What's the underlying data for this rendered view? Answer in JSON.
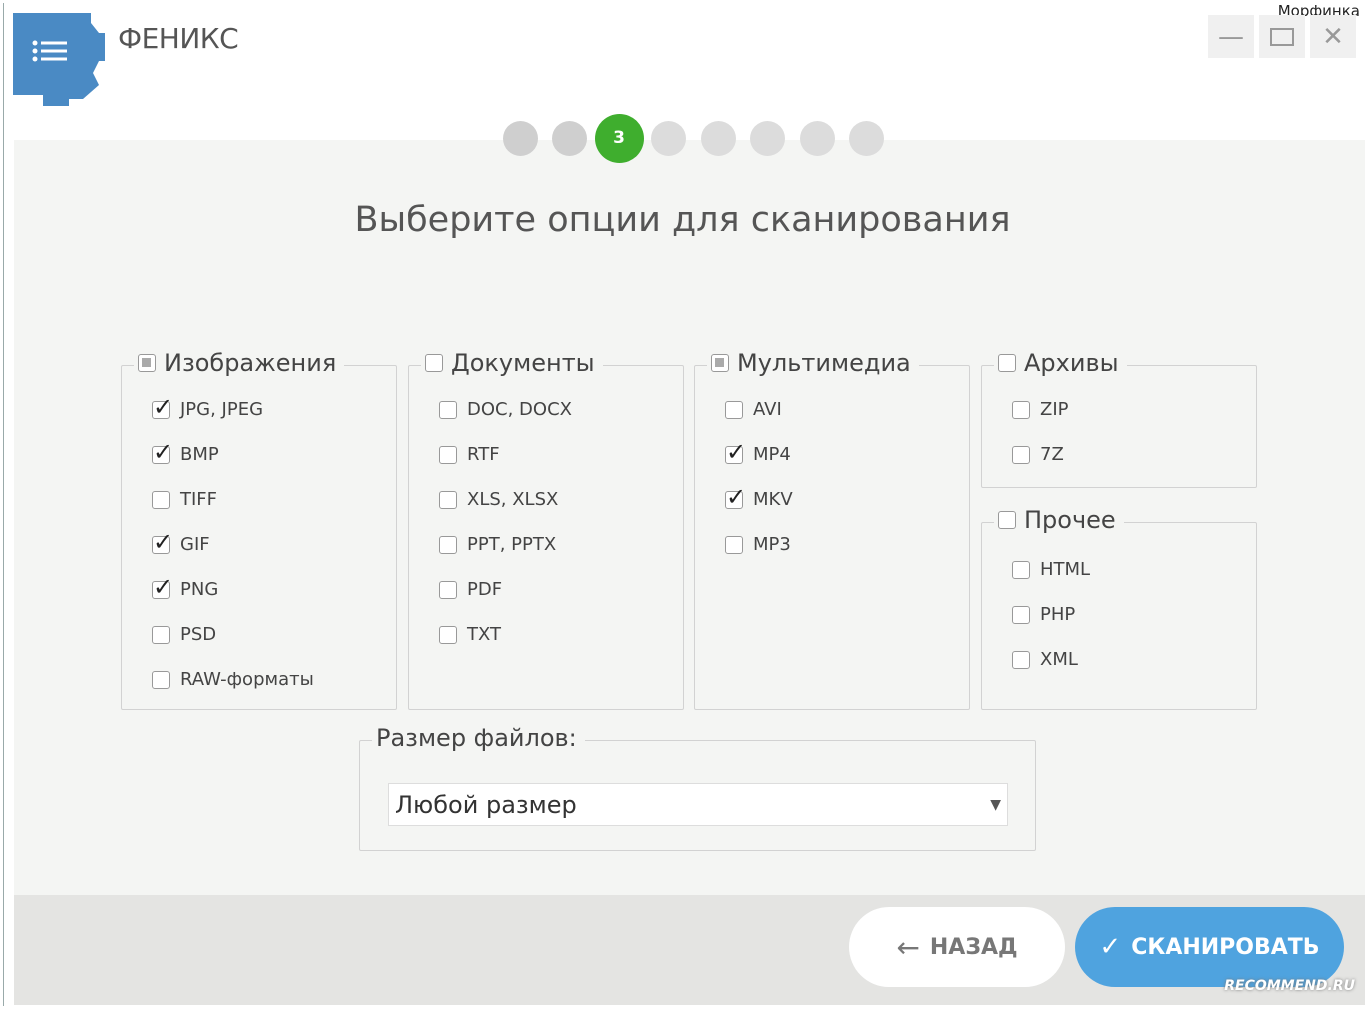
{
  "app": {
    "title": "ФЕНИКС",
    "user": "Морфинка"
  },
  "steps": {
    "current": "3",
    "total": 8,
    "current_index": 3
  },
  "heading": "Выберите опции для сканирования",
  "groups": [
    {
      "label": "Изображения",
      "state": "indeterminate",
      "items": [
        {
          "label": "JPG, JPEG",
          "checked": true
        },
        {
          "label": "BMP",
          "checked": true
        },
        {
          "label": "TIFF",
          "checked": false
        },
        {
          "label": "GIF",
          "checked": true
        },
        {
          "label": "PNG",
          "checked": true
        },
        {
          "label": "PSD",
          "checked": false
        },
        {
          "label": "RAW-форматы",
          "checked": false
        }
      ]
    },
    {
      "label": "Документы",
      "state": "unchecked",
      "items": [
        {
          "label": "DOC, DOCX",
          "checked": false
        },
        {
          "label": "RTF",
          "checked": false
        },
        {
          "label": "XLS, XLSX",
          "checked": false
        },
        {
          "label": "PPT, PPTX",
          "checked": false
        },
        {
          "label": "PDF",
          "checked": false
        },
        {
          "label": "TXT",
          "checked": false
        }
      ]
    },
    {
      "label": "Мультимедиа",
      "state": "indeterminate",
      "items": [
        {
          "label": "AVI",
          "checked": false
        },
        {
          "label": "MP4",
          "checked": true
        },
        {
          "label": "MKV",
          "checked": true
        },
        {
          "label": "MP3",
          "checked": false
        }
      ]
    },
    {
      "label": "Архивы",
      "state": "unchecked",
      "items": [
        {
          "label": "ZIP",
          "checked": false
        },
        {
          "label": "7Z",
          "checked": false
        }
      ]
    },
    {
      "label": "Прочее",
      "state": "unchecked",
      "items": [
        {
          "label": "HTML",
          "checked": false
        },
        {
          "label": "PHP",
          "checked": false
        },
        {
          "label": "XML",
          "checked": false
        }
      ]
    }
  ],
  "filesize": {
    "label": "Размер файлов:",
    "value": "Любой размер"
  },
  "buttons": {
    "back": "НАЗАД",
    "scan": "СКАНИРОВАТЬ"
  },
  "watermark": "RECOMMEND.RU",
  "colors": {
    "accent": "#4fa3df",
    "step_active": "#3fae2e",
    "logo": "#4a8ac4"
  }
}
